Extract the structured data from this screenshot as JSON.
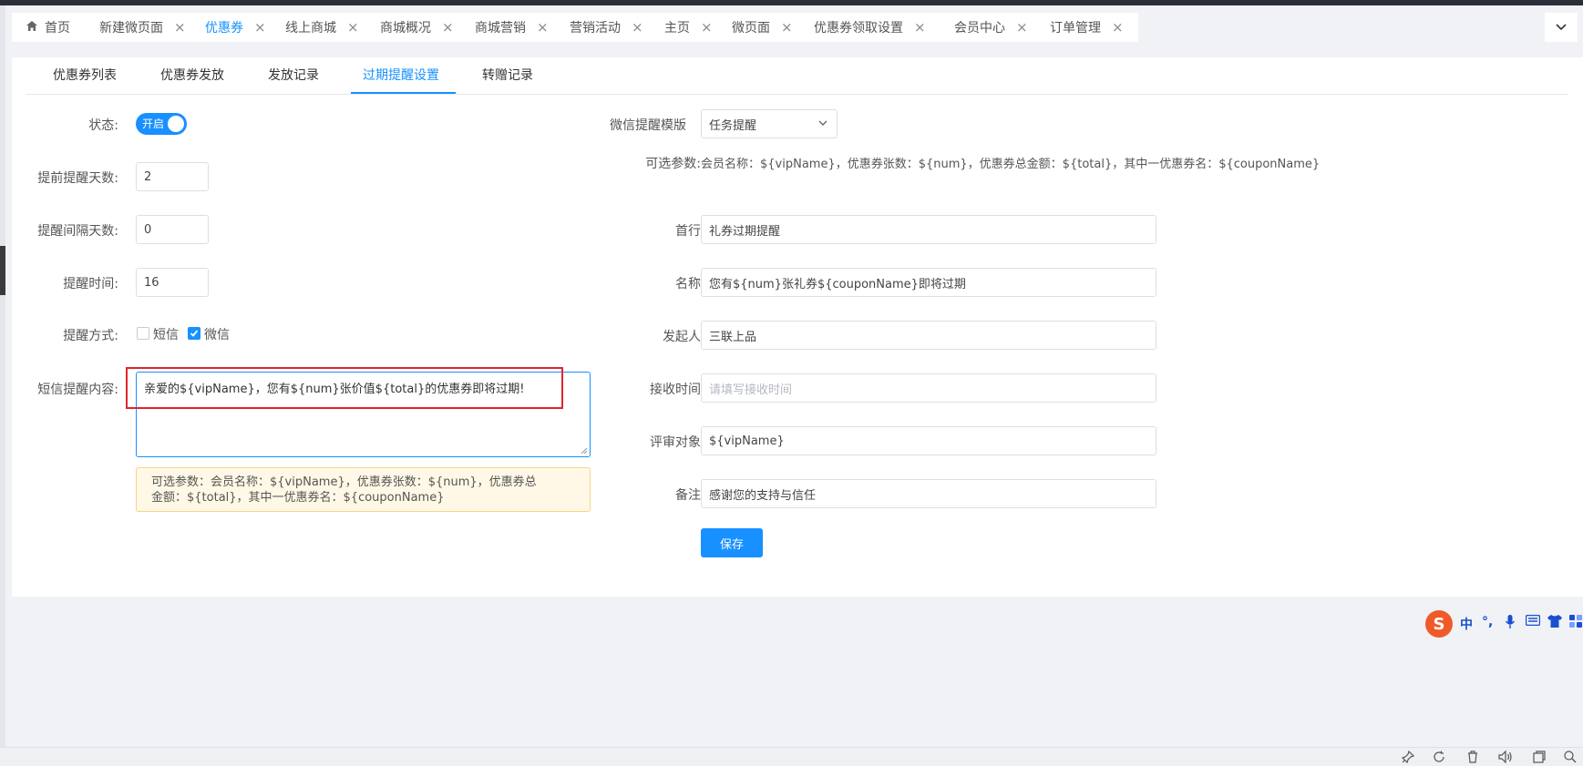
{
  "nav_tabs": [
    {
      "label": "首页",
      "closable": false,
      "home": true
    },
    {
      "label": "新建微页面",
      "closable": true
    },
    {
      "label": "优惠券",
      "closable": true,
      "active": true
    },
    {
      "label": "线上商城",
      "closable": true
    },
    {
      "label": "商城概况",
      "closable": true
    },
    {
      "label": "商城营销",
      "closable": true
    },
    {
      "label": "营销活动",
      "closable": true
    },
    {
      "label": "主页",
      "closable": true
    },
    {
      "label": "微页面",
      "closable": true
    },
    {
      "label": "优惠券领取设置",
      "closable": true
    },
    {
      "label": "会员中心",
      "closable": true
    },
    {
      "label": "订单管理",
      "closable": true
    }
  ],
  "sub_tabs": [
    "优惠券列表",
    "优惠券发放",
    "发放记录",
    "过期提醒设置",
    "转赠记录"
  ],
  "active_sub_tab": "过期提醒设置",
  "left_form": {
    "status_label": "状态:",
    "status_switch_text": "开启",
    "advance_days_label": "提前提醒天数:",
    "advance_days_value": "2",
    "interval_days_label": "提醒间隔天数:",
    "interval_days_value": "0",
    "remind_time_label": "提醒时间:",
    "remind_time_value": "16",
    "remind_method_label": "提醒方式:",
    "method_sms": "短信",
    "method_wechat": "微信",
    "sms_content_label": "短信提醒内容:",
    "sms_content_value": "亲爱的${vipName}，您有${num}张价值${total}的优惠券即将过期!",
    "tip_line1": "可选参数：会员名称：${vipName}，优惠券张数：${num}，优惠券总",
    "tip_line2": "金额：${total}，其中一优惠券名：${couponName}"
  },
  "right_form": {
    "template_label": "微信提醒模版",
    "template_value": "任务提醒",
    "params_label": "可选参数:",
    "params_value": "会员名称：${vipName}，优惠券张数：${num}，优惠券总金额：${total}，其中一优惠券名：${couponName}",
    "first_line_label": "首行",
    "first_line_value": "礼券过期提醒",
    "name_label": "名称",
    "name_value": "您有${num}张礼券${couponName}即将过期",
    "sender_label": "发起人",
    "sender_value": "三联上品",
    "receive_time_label": "接收时间",
    "receive_time_placeholder": "请填写接收时间",
    "review_target_label": "评审对象",
    "review_target_value": "${vipName}",
    "remark_label": "备注",
    "remark_value": "感谢您的支持与信任",
    "save_label": "保存"
  },
  "ime": {
    "logo": "S",
    "mode": "中",
    "punct": "°,"
  },
  "colors": {
    "accent": "#1890ff",
    "highlight_box": "#e0252b",
    "tip_bg": "#fff8e6"
  }
}
